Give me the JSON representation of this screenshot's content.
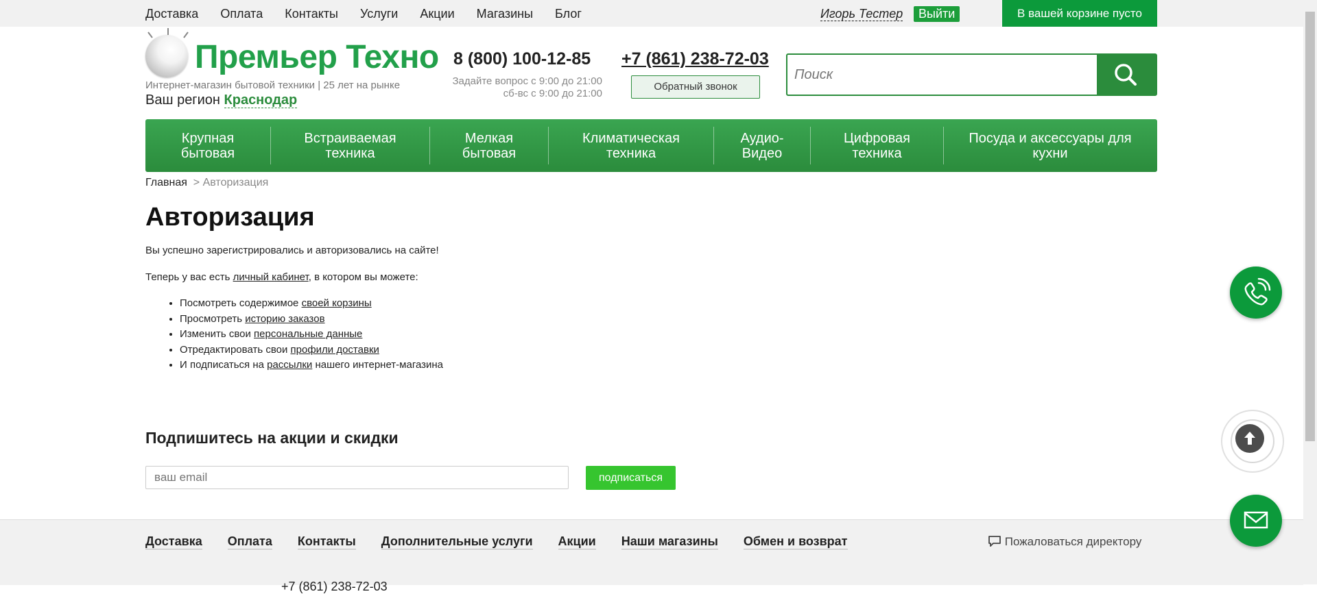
{
  "topbar": {
    "nav": [
      "Доставка",
      "Оплата",
      "Контакты",
      "Услуги",
      "Акции",
      "Магазины",
      "Блог"
    ],
    "user_name": "Игорь Тестер",
    "logout": "Выйти",
    "cart": "В вашей корзине пусто"
  },
  "header": {
    "logo_text": "Премьер Техно",
    "tagline": "Интернет-магазин бытовой техники | 25 лет на рынке",
    "region_label": "Ваш регион",
    "region_value": "Краснодар",
    "phone1": "8 (800) 100-12-85",
    "hours1": "Задайте вопрос с 9:00 до 21:00",
    "hours2": "сб-вс с 9:00 до 21:00",
    "phone2": "+7 (861) 238-72-03",
    "callback": "Обратный звонок",
    "search_placeholder": "Поиск"
  },
  "mainnav": [
    {
      "line1": "Крупная",
      "line2": "бытовая"
    },
    {
      "line1": "Встраиваемая",
      "line2": "техника"
    },
    {
      "line1": "Мелкая",
      "line2": "бытовая"
    },
    {
      "line1": "Климатическая",
      "line2": "техника"
    },
    {
      "line1": "Аудио-",
      "line2": "Видео"
    },
    {
      "line1": "Цифровая",
      "line2": "техника"
    },
    {
      "line1": "Посуда и аксессуары для",
      "line2": "кухни"
    }
  ],
  "breadcrumb": {
    "home": "Главная",
    "sep": ">",
    "current": "Авторизация"
  },
  "content": {
    "title": "Авторизация",
    "success": "Вы успешно зарегистрировались и авторизовались на сайте!",
    "intro_before": "Теперь у вас есть ",
    "intro_link": "личный кабинет",
    "intro_after": ", в котором вы можете:",
    "items": [
      {
        "before": "Посмотреть содержимое ",
        "link": "своей корзины",
        "after": ""
      },
      {
        "before": "Просмотреть ",
        "link": "историю заказов",
        "after": ""
      },
      {
        "before": "Изменить свои ",
        "link": "персональные данные",
        "after": ""
      },
      {
        "before": "Отредактировать свои ",
        "link": "профили доставки",
        "after": ""
      },
      {
        "before": "И подписаться на ",
        "link": "рассылки",
        "after": " нашего интернет-магазина"
      }
    ]
  },
  "subscribe": {
    "title": "Подпишитесь на акции и скидки",
    "placeholder": "ваш email",
    "button": "подписаться"
  },
  "footer": {
    "nav": [
      "Доставка",
      "Оплата",
      "Контакты",
      "Дополнительные услуги",
      "Акции",
      "Наши магазины",
      "Обмен и возврат"
    ],
    "complain": "Пожаловаться директору",
    "partial": "+7 (861) 238-72-03"
  },
  "colors": {
    "brand_green": "#2b8c3c",
    "cart_green": "#0c9a3b",
    "subscribe_green": "#36c52f"
  }
}
